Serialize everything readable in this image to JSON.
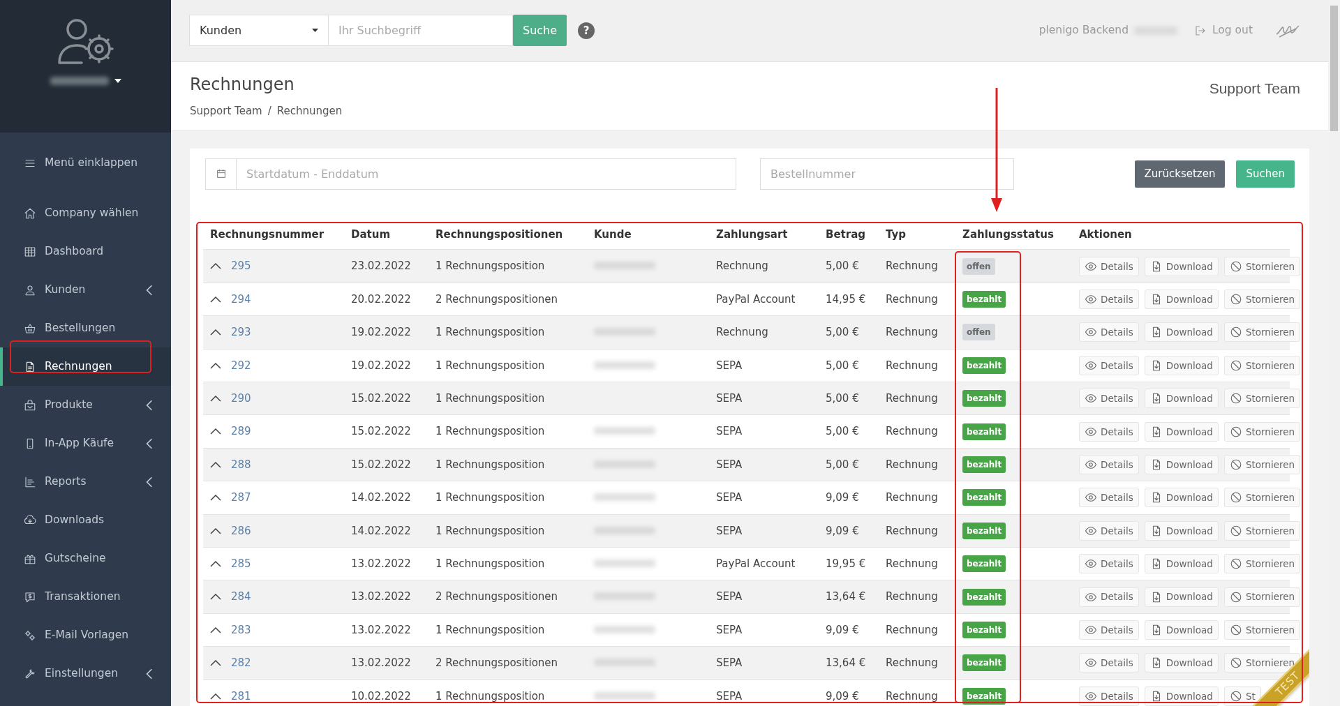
{
  "sidebar": {
    "collapse_label": "Menü einklappen",
    "items": [
      {
        "label": "Company wählen",
        "selected": false,
        "submenu": false
      },
      {
        "label": "Dashboard",
        "selected": false,
        "submenu": false
      },
      {
        "label": "Kunden",
        "selected": false,
        "submenu": true
      },
      {
        "label": "Bestellungen",
        "selected": false,
        "submenu": false
      },
      {
        "label": "Rechnungen",
        "selected": true,
        "submenu": false
      },
      {
        "label": "Produkte",
        "selected": false,
        "submenu": true
      },
      {
        "label": "In-App Käufe",
        "selected": false,
        "submenu": true
      },
      {
        "label": "Reports",
        "selected": false,
        "submenu": true
      },
      {
        "label": "Downloads",
        "selected": false,
        "submenu": false
      },
      {
        "label": "Gutscheine",
        "selected": false,
        "submenu": false
      },
      {
        "label": "Transaktionen",
        "selected": false,
        "submenu": false
      },
      {
        "label": "E-Mail Vorlagen",
        "selected": false,
        "submenu": false
      },
      {
        "label": "Einstellungen",
        "selected": false,
        "submenu": true
      }
    ]
  },
  "topbar": {
    "scope": "Kunden",
    "search_placeholder": "Ihr Suchbegriff",
    "search_button": "Suche",
    "help": "?",
    "account": "plenigo Backend",
    "logout": "Log out"
  },
  "header": {
    "title": "Rechnungen",
    "breadcrumb": [
      "Support Team",
      "Rechnungen"
    ],
    "separator": "/",
    "team": "Support Team"
  },
  "filters": {
    "date_placeholder": "Startdatum - Enddatum",
    "order_placeholder": "Bestellnummer",
    "reset": "Zurücksetzen",
    "search": "Suchen"
  },
  "table": {
    "columns": [
      "Rechnungsnummer",
      "Datum",
      "Rechnungspositionen",
      "Kunde",
      "Zahlungsart",
      "Betrag",
      "Typ",
      "Zahlungsstatus",
      "Aktionen"
    ],
    "rows": [
      {
        "number": "295",
        "date": "23.02.2022",
        "positions": "1 Rechnungsposition",
        "customer_blurred": true,
        "payment": "Rechnung",
        "amount": "5,00 €",
        "type": "Rechnung",
        "status": {
          "label": "offen",
          "kind": "open"
        },
        "actions": [
          "Details",
          "Download",
          "Stornieren"
        ]
      },
      {
        "number": "294",
        "date": "20.02.2022",
        "positions": "2 Rechnungspositionen",
        "customer_blurred": false,
        "payment": "PayPal Account",
        "amount": "14,95 €",
        "type": "Rechnung",
        "status": {
          "label": "bezahlt",
          "kind": "paid"
        },
        "actions": [
          "Details",
          "Download",
          "Stornieren"
        ]
      },
      {
        "number": "293",
        "date": "19.02.2022",
        "positions": "1 Rechnungsposition",
        "customer_blurred": true,
        "payment": "Rechnung",
        "amount": "5,00 €",
        "type": "Rechnung",
        "status": {
          "label": "offen",
          "kind": "open"
        },
        "actions": [
          "Details",
          "Download",
          "Stornieren"
        ]
      },
      {
        "number": "292",
        "date": "19.02.2022",
        "positions": "1 Rechnungsposition",
        "customer_blurred": true,
        "payment": "SEPA",
        "amount": "5,00 €",
        "type": "Rechnung",
        "status": {
          "label": "bezahlt",
          "kind": "paid"
        },
        "actions": [
          "Details",
          "Download",
          "Stornieren"
        ]
      },
      {
        "number": "290",
        "date": "15.02.2022",
        "positions": "1 Rechnungsposition",
        "customer_blurred": false,
        "payment": "SEPA",
        "amount": "5,00 €",
        "type": "Rechnung",
        "status": {
          "label": "bezahlt",
          "kind": "paid"
        },
        "actions": [
          "Details",
          "Download",
          "Stornieren"
        ]
      },
      {
        "number": "289",
        "date": "15.02.2022",
        "positions": "1 Rechnungsposition",
        "customer_blurred": true,
        "payment": "SEPA",
        "amount": "5,00 €",
        "type": "Rechnung",
        "status": {
          "label": "bezahlt",
          "kind": "paid"
        },
        "actions": [
          "Details",
          "Download",
          "Stornieren"
        ]
      },
      {
        "number": "288",
        "date": "15.02.2022",
        "positions": "1 Rechnungsposition",
        "customer_blurred": true,
        "payment": "SEPA",
        "amount": "5,00 €",
        "type": "Rechnung",
        "status": {
          "label": "bezahlt",
          "kind": "paid"
        },
        "actions": [
          "Details",
          "Download",
          "Stornieren"
        ]
      },
      {
        "number": "287",
        "date": "14.02.2022",
        "positions": "1 Rechnungsposition",
        "customer_blurred": true,
        "payment": "SEPA",
        "amount": "9,09 €",
        "type": "Rechnung",
        "status": {
          "label": "bezahlt",
          "kind": "paid"
        },
        "actions": [
          "Details",
          "Download",
          "Stornieren"
        ]
      },
      {
        "number": "286",
        "date": "14.02.2022",
        "positions": "1 Rechnungsposition",
        "customer_blurred": true,
        "payment": "SEPA",
        "amount": "9,09 €",
        "type": "Rechnung",
        "status": {
          "label": "bezahlt",
          "kind": "paid"
        },
        "actions": [
          "Details",
          "Download",
          "Stornieren"
        ]
      },
      {
        "number": "285",
        "date": "13.02.2022",
        "positions": "1 Rechnungsposition",
        "customer_blurred": true,
        "payment": "PayPal Account",
        "amount": "19,95 €",
        "type": "Rechnung",
        "status": {
          "label": "bezahlt",
          "kind": "paid"
        },
        "actions": [
          "Details",
          "Download",
          "Stornieren"
        ]
      },
      {
        "number": "284",
        "date": "13.02.2022",
        "positions": "2 Rechnungspositionen",
        "customer_blurred": true,
        "payment": "SEPA",
        "amount": "13,64 €",
        "type": "Rechnung",
        "status": {
          "label": "bezahlt",
          "kind": "paid"
        },
        "actions": [
          "Details",
          "Download",
          "Stornieren"
        ]
      },
      {
        "number": "283",
        "date": "13.02.2022",
        "positions": "1 Rechnungsposition",
        "customer_blurred": true,
        "payment": "SEPA",
        "amount": "9,09 €",
        "type": "Rechnung",
        "status": {
          "label": "bezahlt",
          "kind": "paid"
        },
        "actions": [
          "Details",
          "Download",
          "Stornieren"
        ]
      },
      {
        "number": "282",
        "date": "13.02.2022",
        "positions": "2 Rechnungspositionen",
        "customer_blurred": true,
        "payment": "SEPA",
        "amount": "13,64 €",
        "type": "Rechnung",
        "status": {
          "label": "bezahlt",
          "kind": "paid"
        },
        "actions": [
          "Details",
          "Download",
          "Stornieren"
        ]
      },
      {
        "number": "281",
        "date": "10.02.2022",
        "positions": "1 Rechnungsposition",
        "customer_blurred": true,
        "payment": "SEPA",
        "amount": "9,09 €",
        "type": "Rechnung",
        "status": {
          "label": "bezahlt",
          "kind": "paid"
        },
        "actions": [
          "Details",
          "Download",
          "St"
        ]
      }
    ]
  },
  "ribbon": "TEST"
}
